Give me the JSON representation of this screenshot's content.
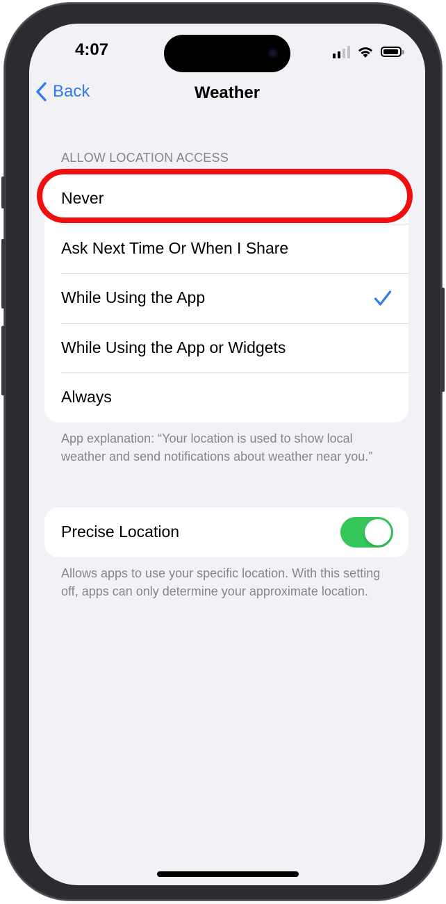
{
  "status_bar": {
    "time": "4:07",
    "signal_bars_active": 2,
    "signal_bars_total": 4,
    "battery_level": 0.9
  },
  "nav": {
    "back_label": "Back",
    "title": "Weather"
  },
  "location_section": {
    "header": "ALLOW LOCATION ACCESS",
    "options": [
      {
        "label": "Never",
        "selected": false
      },
      {
        "label": "Ask Next Time Or When I Share",
        "selected": false
      },
      {
        "label": "While Using the App",
        "selected": true
      },
      {
        "label": "While Using the App or Widgets",
        "selected": false
      },
      {
        "label": "Always",
        "selected": false
      }
    ],
    "footer": "App explanation: “Your location is used to show local weather and send notifications about weather near you.”"
  },
  "precise_location": {
    "label": "Precise Location",
    "enabled": true,
    "footer": "Allows apps to use your specific location. With this setting off, apps can only determine your approximate location."
  },
  "colors": {
    "accent": "#2f7bf5",
    "toggle_on": "#34c659",
    "highlight": "#ee1010",
    "background": "#f2f1f6",
    "secondary_text": "#86858b"
  },
  "icons": [
    "back-chevron-icon",
    "checkmark-icon",
    "wifi-icon",
    "battery-icon",
    "signal-icon"
  ]
}
